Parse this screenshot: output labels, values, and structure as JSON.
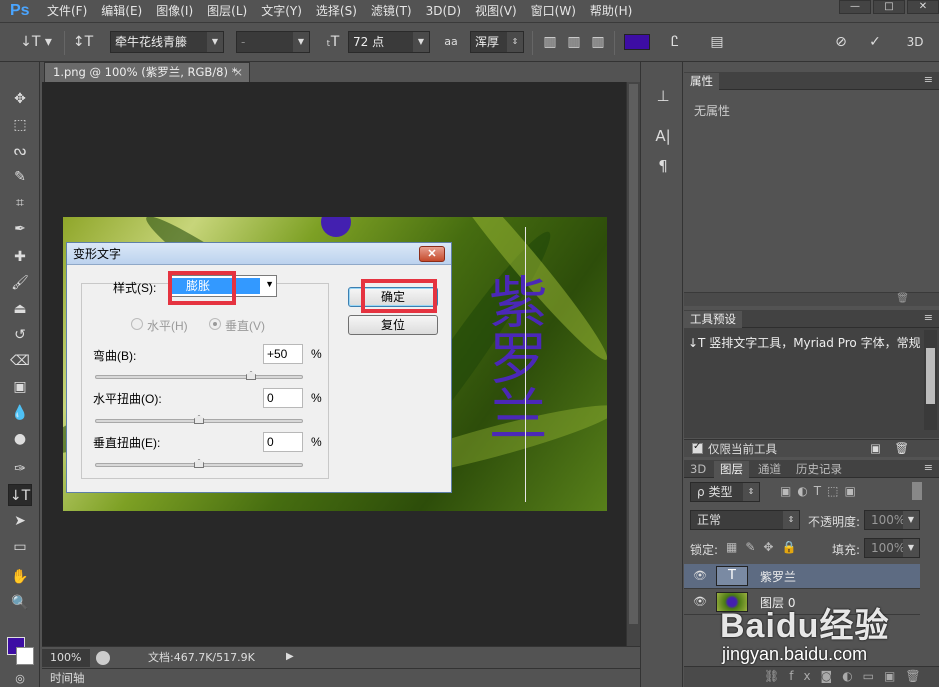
{
  "app": {
    "logo": "Ps"
  },
  "menu": [
    "文件(F)",
    "编辑(E)",
    "图像(I)",
    "图层(L)",
    "文字(Y)",
    "选择(S)",
    "滤镜(T)",
    "3D(D)",
    "视图(V)",
    "窗口(W)",
    "帮助(H)"
  ],
  "window_controls": {
    "minimize": "—",
    "maximize": "□",
    "close": "✕"
  },
  "options": {
    "font_family": "牵牛花线青籐",
    "font_style": "-",
    "font_size": "72 点",
    "antialias_icon": "aa",
    "antialias": "浑厚",
    "text_color": "#3d0da4"
  },
  "document": {
    "tab_title": "1.png @ 100% (紫罗兰, RGB/8) *",
    "tab_close": "×",
    "zoom": "100%",
    "doc_size": "文档:467.7K/517.9K",
    "timeline": "时间轴",
    "canvas_text": "紫罗兰"
  },
  "dialog": {
    "title": "变形文字",
    "close": "✕",
    "style_label": "样式(S):",
    "style_value": "膨胀",
    "horizontal": "水平(H)",
    "vertical": "垂直(V)",
    "bend_label": "弯曲(B):",
    "bend_value": "+50",
    "hdistort_label": "水平扭曲(O):",
    "hdistort_value": "0",
    "vdistort_label": "垂直扭曲(E):",
    "vdistort_value": "0",
    "percent": "%",
    "ok": "确定",
    "reset": "复位",
    "bend_fraction": 0.75,
    "hdistort_fraction": 0.5,
    "vdistort_fraction": 0.5,
    "highlight_color": "#e53340"
  },
  "properties": {
    "tab": "属性",
    "empty": "无属性"
  },
  "tool_presets": {
    "tab": "工具预设",
    "item": "竖排文字工具，Myriad Pro 字体，常规",
    "current_only": "仅限当前工具"
  },
  "layers": {
    "tabs": [
      "3D",
      "图层",
      "通道",
      "历史记录"
    ],
    "filter_kind": "类型",
    "blend_mode": "正常",
    "opacity_label": "不透明度:",
    "opacity_value": "100%",
    "lock_label": "锁定:",
    "fill_label": "填充:",
    "fill_value": "100%",
    "items": [
      {
        "name": "紫罗兰",
        "thumb": "T"
      },
      {
        "name": "图层 0",
        "thumb": ""
      }
    ]
  },
  "watermark": {
    "brand": "Baidu经验",
    "url": "jingyan.baidu.com"
  }
}
